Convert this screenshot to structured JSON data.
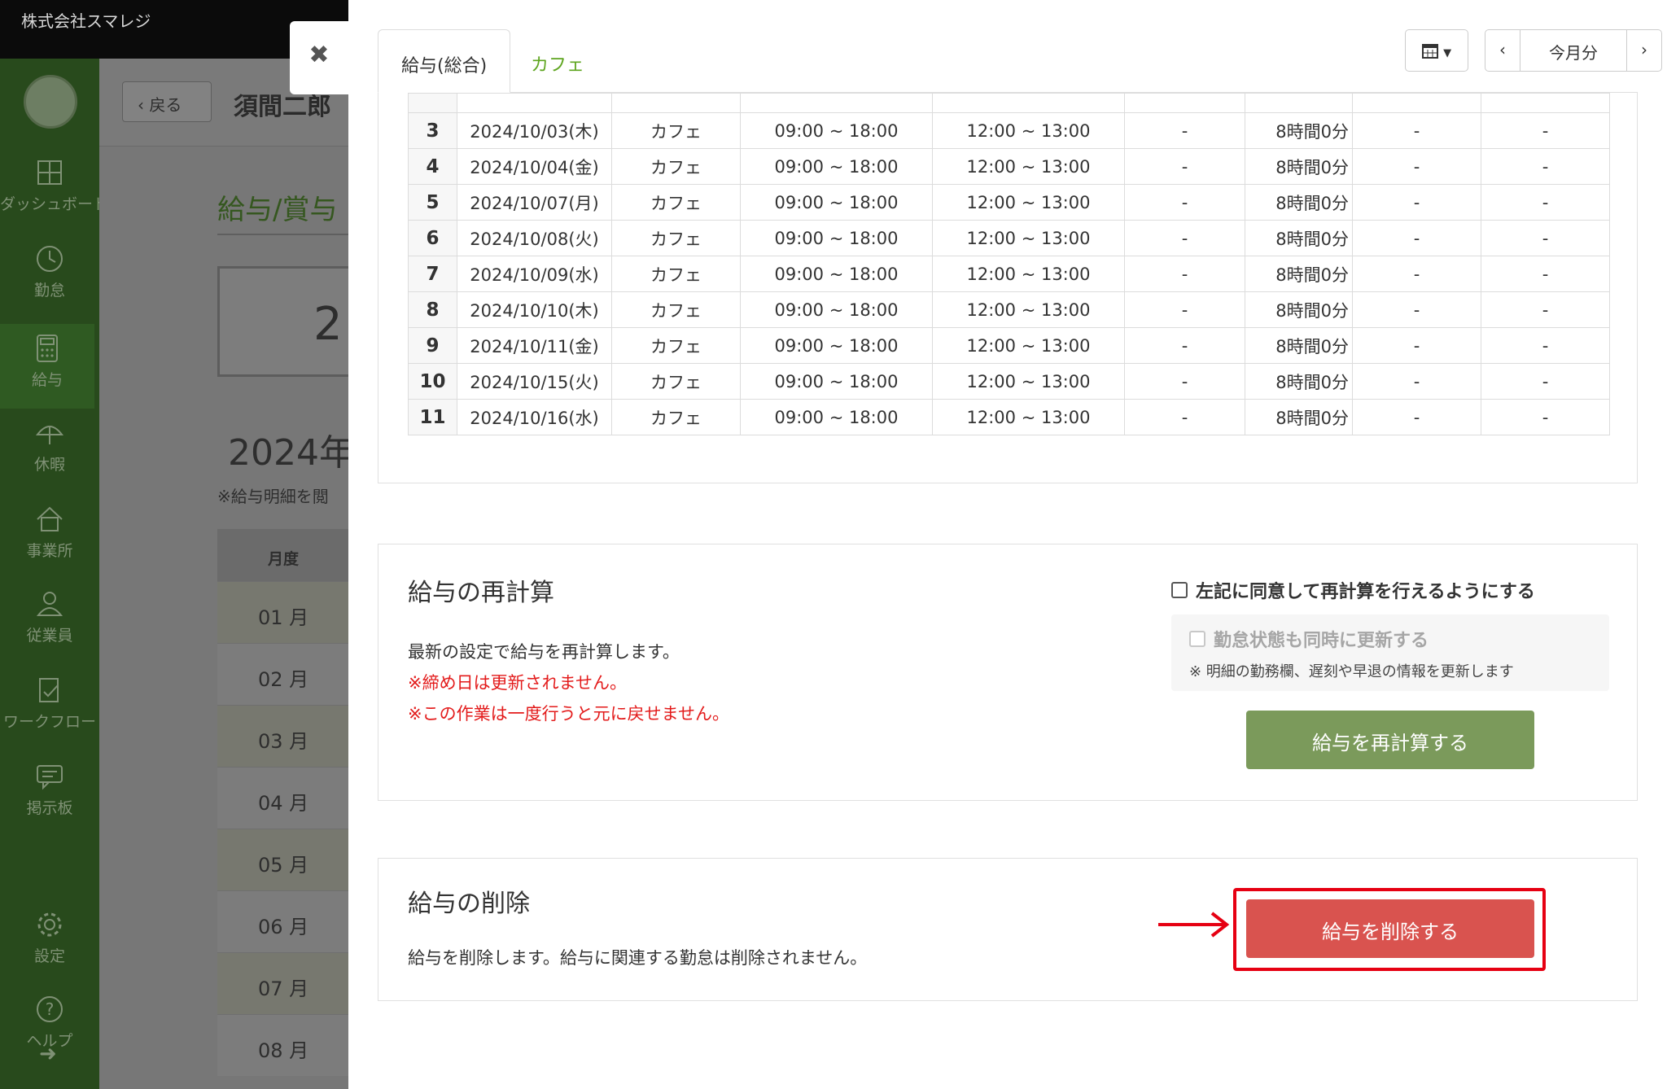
{
  "app": {
    "company": "株式会社スマレジ"
  },
  "sidebar": {
    "items": [
      {
        "label": "ダッシュボード",
        "icon": "dashboard-icon"
      },
      {
        "label": "勤怠",
        "icon": "clock-icon"
      },
      {
        "label": "給与",
        "icon": "calculator-icon"
      },
      {
        "label": "休暇",
        "icon": "umbrella-icon"
      },
      {
        "label": "事業所",
        "icon": "home-icon"
      },
      {
        "label": "従業員",
        "icon": "person-icon"
      },
      {
        "label": "ワークフロー",
        "icon": "workflow-icon"
      },
      {
        "label": "掲示板",
        "icon": "board-icon"
      },
      {
        "label": "設定",
        "icon": "gear-icon"
      },
      {
        "label": "ヘルプ",
        "icon": "help-icon"
      }
    ],
    "active": "給与"
  },
  "background": {
    "back_label": "戻る",
    "person_name": "須間二郎",
    "page_title": "給与/賞与",
    "box_value": "2",
    "year_heading": "2024年",
    "note": "※給与明細を閲",
    "table_header": "月度",
    "months": [
      "01 月",
      "02 月",
      "03 月",
      "04 月",
      "05 月",
      "06 月",
      "07 月",
      "08 月"
    ]
  },
  "modal": {
    "close_symbol": "✖",
    "tabs": [
      {
        "label": "給与(総合)",
        "active": true
      },
      {
        "label": "カフェ",
        "active": false
      }
    ],
    "nav": {
      "calendar_icon": "calendar-icon",
      "prev": "‹",
      "current": "今月分",
      "next": "›"
    },
    "attendance_rows": [
      {
        "no": "3",
        "date": "2024/10/03(木)",
        "shop": "カフェ",
        "shift": "09:00 ~ 18:00",
        "break": "12:00 ~ 13:00",
        "a": "-",
        "hours": "8時間0分",
        "b": "-",
        "c": "-"
      },
      {
        "no": "4",
        "date": "2024/10/04(金)",
        "shop": "カフェ",
        "shift": "09:00 ~ 18:00",
        "break": "12:00 ~ 13:00",
        "a": "-",
        "hours": "8時間0分",
        "b": "-",
        "c": "-"
      },
      {
        "no": "5",
        "date": "2024/10/07(月)",
        "shop": "カフェ",
        "shift": "09:00 ~ 18:00",
        "break": "12:00 ~ 13:00",
        "a": "-",
        "hours": "8時間0分",
        "b": "-",
        "c": "-"
      },
      {
        "no": "6",
        "date": "2024/10/08(火)",
        "shop": "カフェ",
        "shift": "09:00 ~ 18:00",
        "break": "12:00 ~ 13:00",
        "a": "-",
        "hours": "8時間0分",
        "b": "-",
        "c": "-"
      },
      {
        "no": "7",
        "date": "2024/10/09(水)",
        "shop": "カフェ",
        "shift": "09:00 ~ 18:00",
        "break": "12:00 ~ 13:00",
        "a": "-",
        "hours": "8時間0分",
        "b": "-",
        "c": "-"
      },
      {
        "no": "8",
        "date": "2024/10/10(木)",
        "shop": "カフェ",
        "shift": "09:00 ~ 18:00",
        "break": "12:00 ~ 13:00",
        "a": "-",
        "hours": "8時間0分",
        "b": "-",
        "c": "-"
      },
      {
        "no": "9",
        "date": "2024/10/11(金)",
        "shop": "カフェ",
        "shift": "09:00 ~ 18:00",
        "break": "12:00 ~ 13:00",
        "a": "-",
        "hours": "8時間0分",
        "b": "-",
        "c": "-"
      },
      {
        "no": "10",
        "date": "2024/10/15(火)",
        "shop": "カフェ",
        "shift": "09:00 ~ 18:00",
        "break": "12:00 ~ 13:00",
        "a": "-",
        "hours": "8時間0分",
        "b": "-",
        "c": "-"
      },
      {
        "no": "11",
        "date": "2024/10/16(水)",
        "shop": "カフェ",
        "shift": "09:00 ~ 18:00",
        "break": "12:00 ~ 13:00",
        "a": "-",
        "hours": "8時間0分",
        "b": "-",
        "c": "-"
      }
    ],
    "recalc": {
      "title": "給与の再計算",
      "description": "最新の設定で給与を再計算します。",
      "warning1": "※締め日は更新されません。",
      "warning2": "※この作業は一度行うと元に戻せません。",
      "agree_label": "左記に同意して再計算を行えるようにする",
      "agree_checked": false,
      "sub_label": "勤怠状態も同時に更新する",
      "sub_checked": false,
      "sub_note": "※ 明細の勤務欄、遅刻や早退の情報を更新します",
      "button": "給与を再計算する"
    },
    "delete": {
      "title": "給与の削除",
      "description": "給与を削除します。給与に関連する勤怠は削除されません。",
      "button": "給与を削除する"
    }
  },
  "colors": {
    "accent_green": "#5ea51f",
    "recalc_button": "#7b9a5b",
    "delete_button": "#d9534f",
    "highlight_red": "#e60012",
    "warning_red": "#e31b1b"
  }
}
